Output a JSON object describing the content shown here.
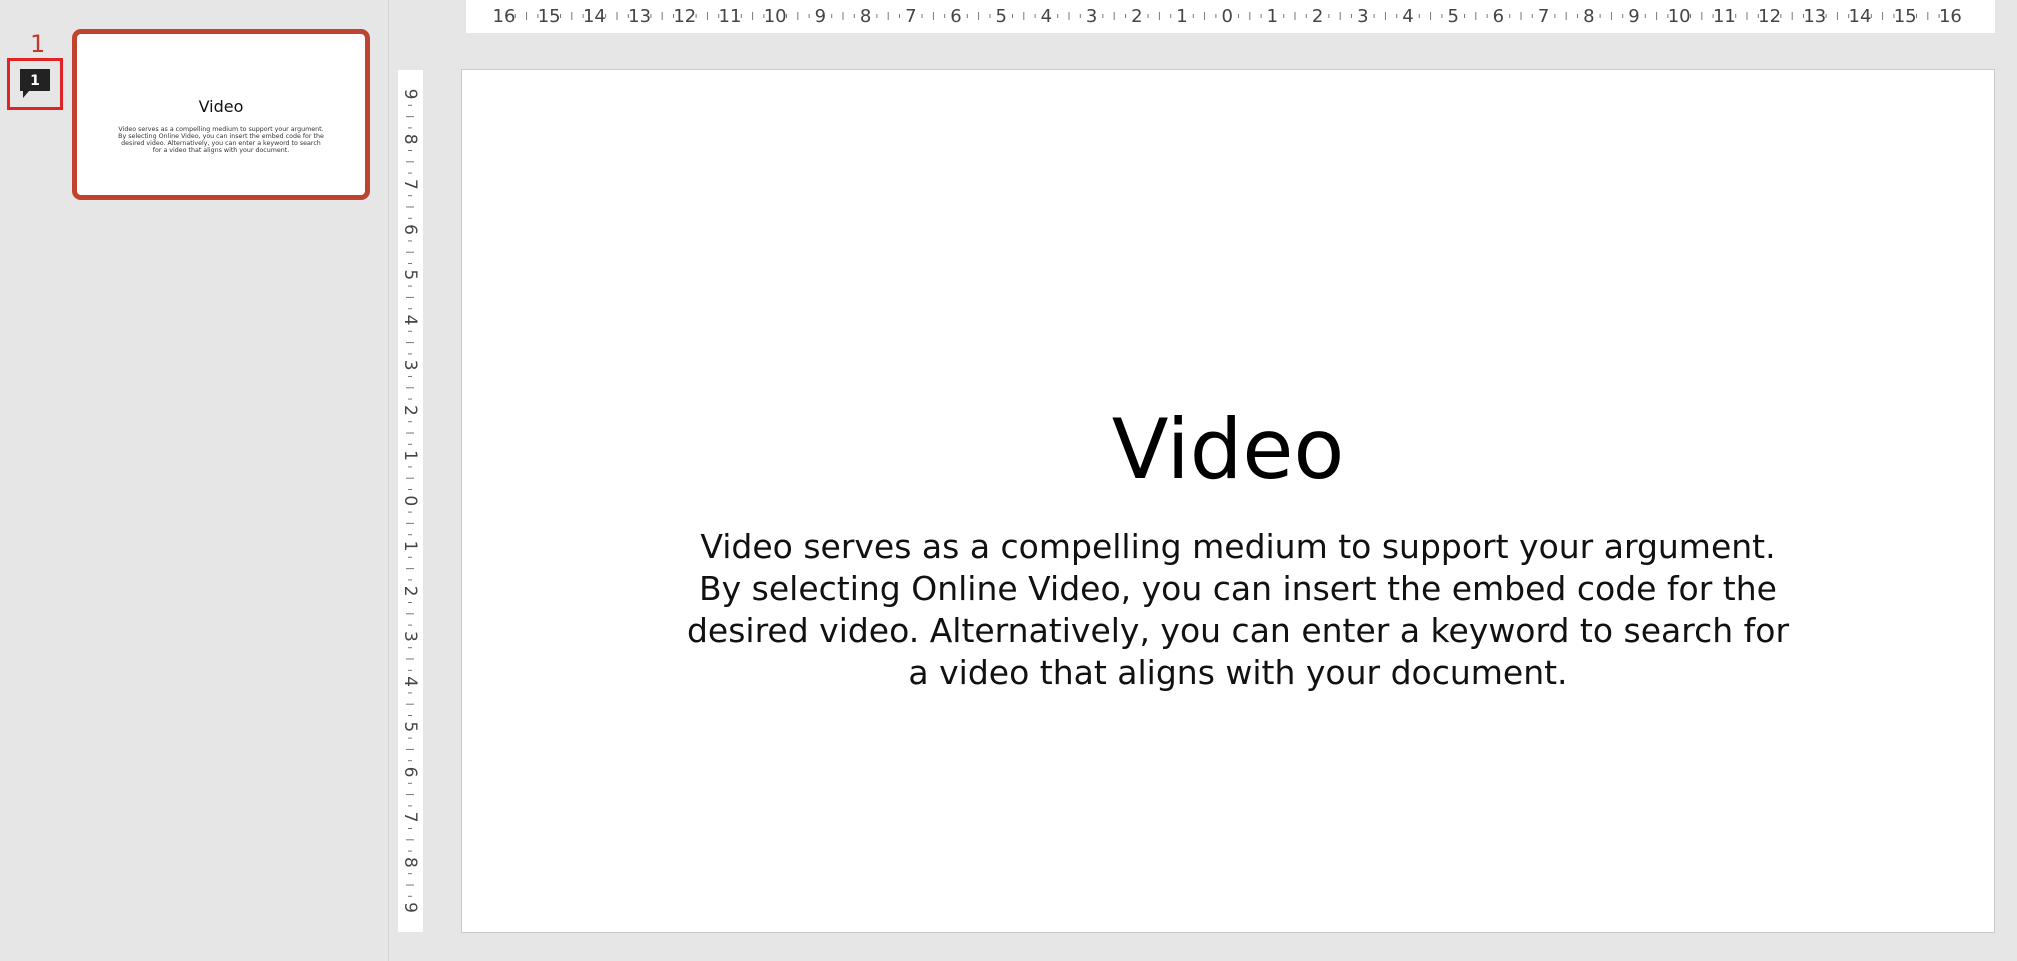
{
  "thumbnails": {
    "slide_number": "1",
    "comment_count": "1",
    "items": [
      {
        "title": "Video",
        "body": "Video serves as a compelling medium to support your argument. By selecting Online Video, you can insert the embed code for the desired video. Alternatively, you can enter a keyword to search for a video that aligns with your document."
      }
    ]
  },
  "ruler": {
    "horizontal": [
      "16",
      "15",
      "14",
      "13",
      "12",
      "11",
      "10",
      "9",
      "8",
      "7",
      "6",
      "5",
      "4",
      "3",
      "2",
      "1",
      "0",
      "1",
      "2",
      "3",
      "4",
      "5",
      "6",
      "7",
      "8",
      "9",
      "10",
      "11",
      "12",
      "13",
      "14",
      "15",
      "16"
    ],
    "vertical": [
      "9",
      "8",
      "7",
      "6",
      "5",
      "4",
      "3",
      "2",
      "1",
      "0",
      "1",
      "2",
      "3",
      "4",
      "5",
      "6",
      "7",
      "8",
      "9"
    ]
  },
  "slide": {
    "title": "Video",
    "body": "Video serves as a compelling medium to support your argument. By selecting Online Video, you can insert the embed code for the desired video. Alternatively, you can enter a keyword to search for a video that aligns with your document."
  },
  "colors": {
    "selection_border": "#c0432f",
    "comment_highlight": "#e02424",
    "comment_icon": "#222222",
    "workspace_bg": "#e6e6e6"
  },
  "icons": {
    "comment": "comment-bubble-icon"
  }
}
